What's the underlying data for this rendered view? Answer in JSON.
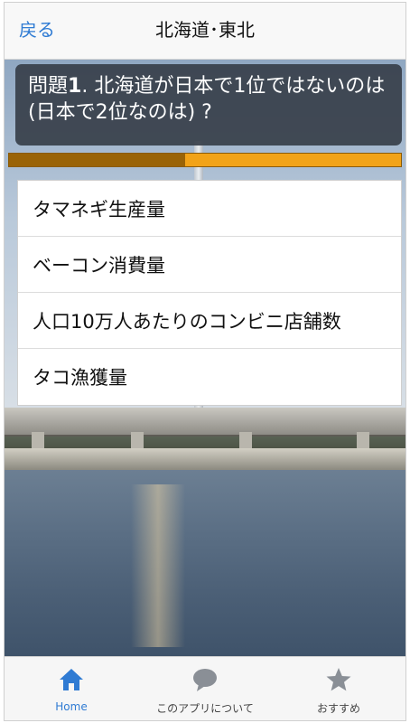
{
  "header": {
    "back_label": "戻る",
    "title": "北海道･東北"
  },
  "question": {
    "prefix": "問題",
    "number": "1",
    "text": ". 北海道が日本で1位ではないのは(日本で2位なのは) ?"
  },
  "progress": {
    "fraction": 0.45
  },
  "answers": [
    {
      "label": "タマネギ生産量"
    },
    {
      "label": "ベーコン消費量"
    },
    {
      "label": "人口10万人あたりのコンビニ店舗数"
    },
    {
      "label": "タコ漁獲量"
    }
  ],
  "tabs": [
    {
      "label": "Home",
      "icon": "home-icon",
      "active": true
    },
    {
      "label": "このアプリについて",
      "icon": "chat-bubble-icon",
      "active": false
    },
    {
      "label": "おすすめ",
      "icon": "star-icon",
      "active": false
    }
  ],
  "colors": {
    "accent": "#2f7bd3",
    "progress_bg": "#f2a318",
    "progress_fill": "#9a6306"
  }
}
